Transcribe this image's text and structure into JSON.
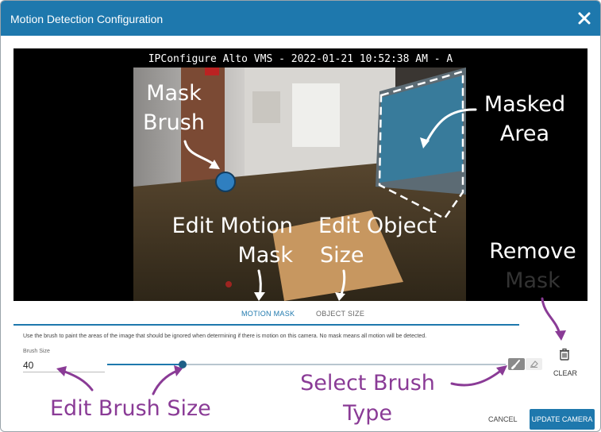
{
  "dialog": {
    "title": "Motion Detection Configuration",
    "close_icon": "close-icon"
  },
  "video": {
    "overlay_text": "IPConfigure Alto VMS - 2022-01-21 10:52:38 AM - A"
  },
  "annotations": {
    "mask_brush": [
      "Mask",
      "Brush"
    ],
    "masked_area": [
      "Masked",
      "Area"
    ],
    "edit_motion_mask": [
      "Edit Motion",
      "Mask"
    ],
    "edit_object_size": [
      "Edit Object",
      "Size"
    ],
    "remove_mask": [
      "Remove",
      "Mask"
    ],
    "edit_brush_size": "Edit Brush Size",
    "select_brush_type": [
      "Select Brush",
      "Type"
    ]
  },
  "tabs": [
    {
      "label": "MOTION MASK",
      "active": true
    },
    {
      "label": "OBJECT SIZE",
      "active": false
    }
  ],
  "hint": "Use the brush to paint the areas of the image that should be ignored when determining if there is motion on this camera. No mask means all motion will be detected.",
  "brush_size": {
    "label": "Brush Size",
    "value": "40",
    "slider_fraction": 0.19
  },
  "tools": {
    "brush_icon": "paint-brush-icon",
    "eraser_icon": "eraser-icon",
    "selected": "brush"
  },
  "clear": {
    "icon": "trash-icon",
    "label": "CLEAR"
  },
  "footer": {
    "cancel_label": "CANCEL",
    "update_label": "UPDATE CAMERA"
  },
  "colors": {
    "primary": "#1e78ad",
    "annotation_purple": "#8a3b96"
  }
}
